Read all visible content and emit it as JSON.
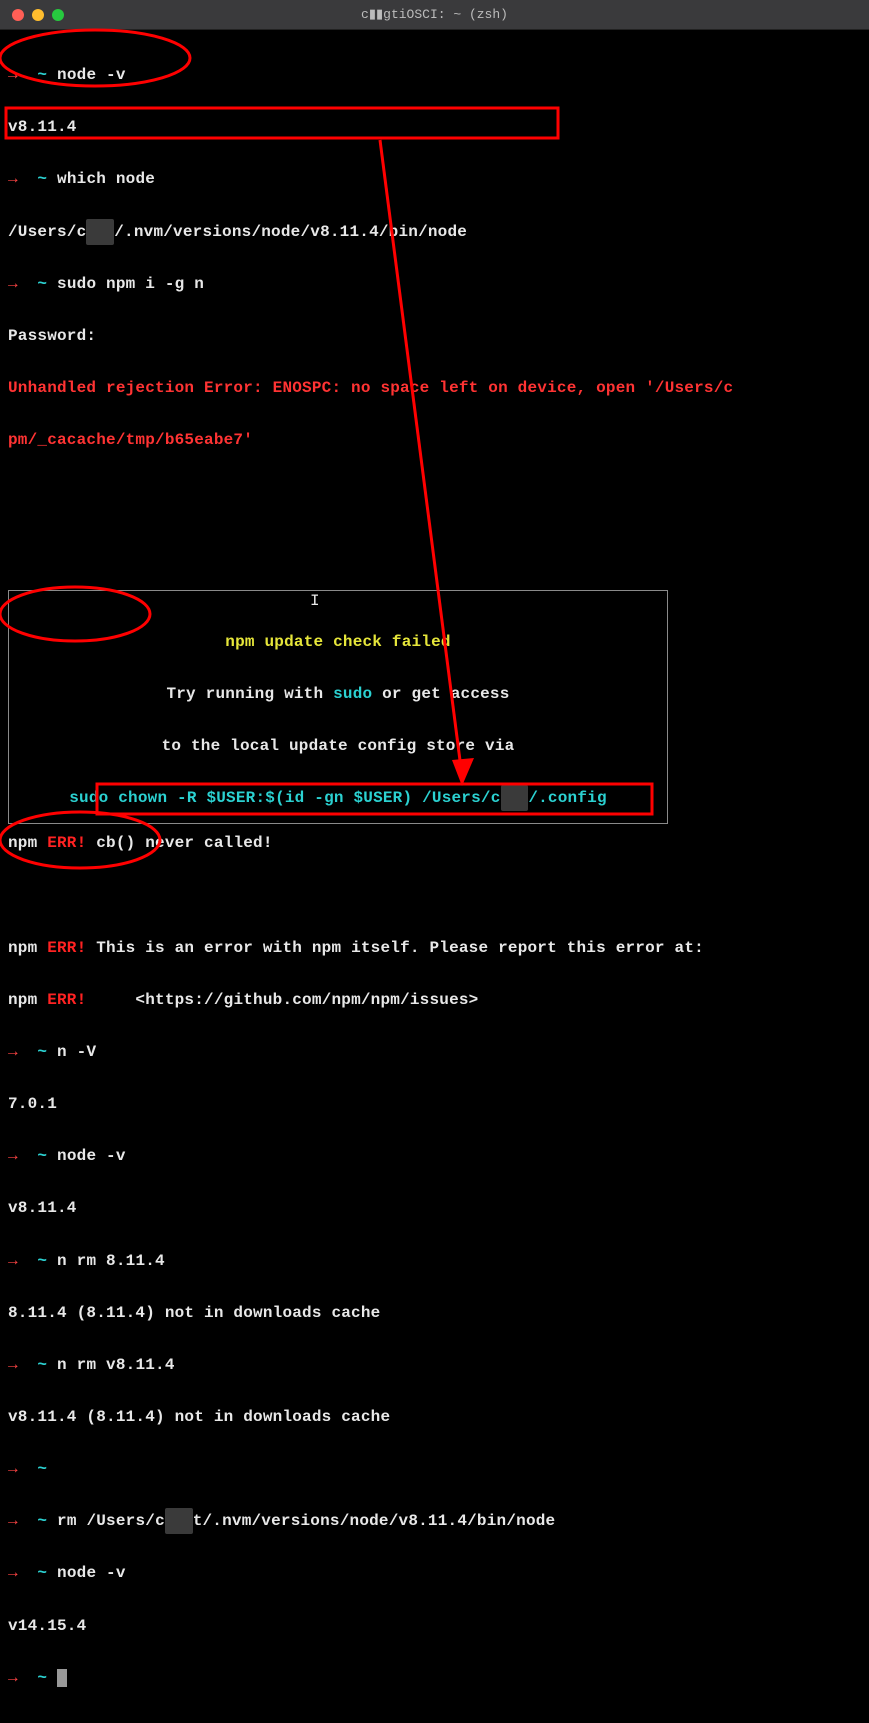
{
  "titlebar": {
    "title": "c▮▮gtiOSCI: ~ (zsh)"
  },
  "lines": {
    "l1_cmd": "node -v",
    "l2_out": "v8.11.4",
    "l3_cmd": "which node",
    "l4_out_a": "/Users/c",
    "l4_out_b": "/.nvm/versions/node/v8.11.4/bin/node",
    "l5_cmd": "sudo npm i -g n",
    "l6_out": "Password:",
    "l7_err": "Unhandled rejection Error: ENOSPC: no space left on device, open '/Users/c",
    "l8_err": "pm/_cacache/tmp/b65eabe7'",
    "box_line1": "npm update check failed",
    "box_line2a": "Try running with ",
    "box_line2b": "sudo",
    "box_line2c": " or get access",
    "box_line3": "to the local update config store via",
    "box_line4a": "sudo chown -R $USER:$(id -gn $USER) /Users/c",
    "box_line4b": "/.config",
    "l9_npm": "npm",
    "l9_err": " ERR!",
    "l9_out": " cb() never called!",
    "l10_npm": "npm",
    "l10_err": " ERR!",
    "l10_out": " This is an error with npm itself. Please report this error at:",
    "l11_npm": "npm",
    "l11_err": " ERR!",
    "l11_out": "     <https://github.com/npm/npm/issues>",
    "l12_cmd": "n -V",
    "l13_out": "7.0.1",
    "l14_cmd": "node -v",
    "l15_out": "v8.11.4",
    "l16_cmd": "n rm 8.11.4",
    "l17_out": "8.11.4 (8.11.4) not in downloads cache",
    "l18_cmd": "n rm v8.11.4",
    "l19_out": "v8.11.4 (8.11.4) not in downloads cache",
    "l20_cmd_a": "rm ",
    "l20_cmd_b": "/Users/c",
    "l20_cmd_c": "t/.nvm/versions/node/v8.11.4/bin/node",
    "l21_cmd": "node -v",
    "l22_out": "v14.15.4",
    "redact_token": "▮▮t"
  },
  "prompt": {
    "arrow": "→",
    "tilde": "~"
  }
}
